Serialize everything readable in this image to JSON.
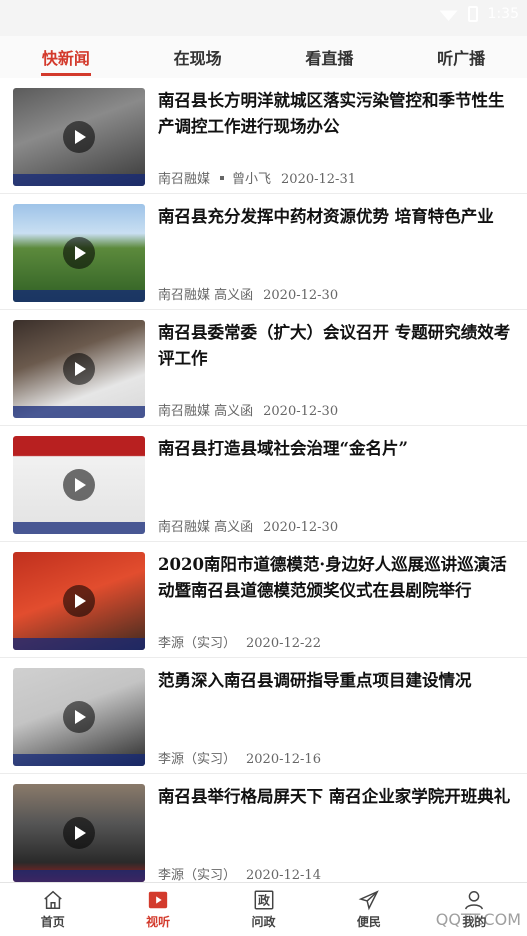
{
  "status_bar": {
    "time": "1:35"
  },
  "tabs": [
    {
      "label": "快新闻"
    },
    {
      "label": "在现场"
    },
    {
      "label": "看直播"
    },
    {
      "label": "听广播"
    }
  ],
  "active_tab_color": "#d33a2c",
  "news": [
    {
      "title": "南召县长方明洋就城区落实污染管控和季节性生产调控工作进行现场办公",
      "source": "南召融媒",
      "author": "曾小飞",
      "date": "2020-12-31"
    },
    {
      "title": "南召县充分发挥中药材资源优势 培育特色产业",
      "source": "南召融媒 高义函",
      "date": "2020-12-30"
    },
    {
      "title": "南召县委常委（扩大）会议召开 专题研究绩效考评工作",
      "source": "南召融媒 高义函",
      "date": "2020-12-30"
    },
    {
      "title": "南召县打造县域社会治理“金名片”",
      "source": "南召融媒 高义函",
      "date": "2020-12-30"
    },
    {
      "title": "2020南阳市道德模范·身边好人巡展巡讲巡演活动暨南召县道德模范颁奖仪式在县剧院举行",
      "source": "李源（实习）",
      "date": "2020-12-22"
    },
    {
      "title": "范勇深入南召县调研指导重点项目建设情况",
      "source": "李源（实习）",
      "date": "2020-12-16"
    },
    {
      "title": "南召县举行格局屏天下 南召企业家学院开班典礼",
      "source": "李源（实习）",
      "date": "2020-12-14"
    }
  ],
  "bottom_nav": [
    {
      "label": "首页",
      "icon": "home-icon"
    },
    {
      "label": "视听",
      "icon": "video-icon"
    },
    {
      "label": "问政",
      "icon": "politics-icon"
    },
    {
      "label": "便民",
      "icon": "send-icon"
    },
    {
      "label": "我的",
      "icon": "user-icon"
    }
  ],
  "watermark": "QQTT.COM"
}
